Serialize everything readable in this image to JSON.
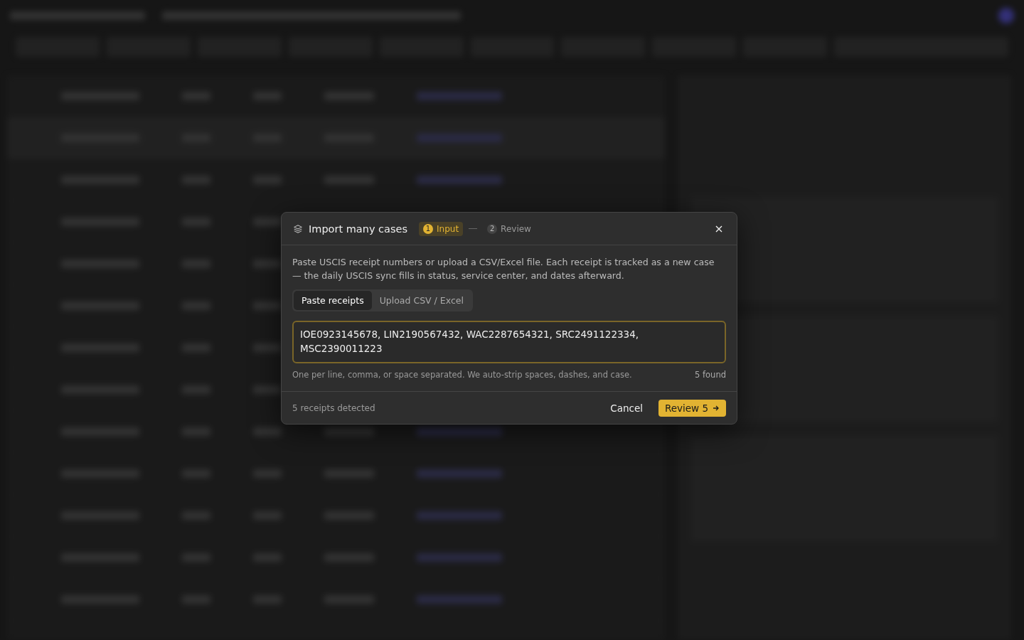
{
  "dialog": {
    "title": "Import many cases",
    "steps": [
      {
        "number": "1",
        "label": "Input",
        "selected": true
      },
      {
        "number": "2",
        "label": "Review",
        "selected": false
      }
    ],
    "description": "Paste USCIS receipt numbers or upload a CSV/Excel file. Each receipt is tracked as a new case — the daily USCIS sync fills in status, service center, and dates afterward.",
    "tabs": [
      {
        "label": "Paste receipts",
        "selected": true
      },
      {
        "label": "Upload CSV / Excel",
        "selected": false
      }
    ],
    "receipts_field": {
      "value": "IOE0923145678, LIN2190567432, WAC2287654321, SRC2491122334, MSC2390011223"
    },
    "hint": "One per line, comma, or space separated. We auto-strip spaces, dashes, and case.",
    "found": "5 found",
    "footer_note": "5 receipts detected",
    "buttons": {
      "cancel": "Cancel",
      "review": "Review 5"
    }
  }
}
